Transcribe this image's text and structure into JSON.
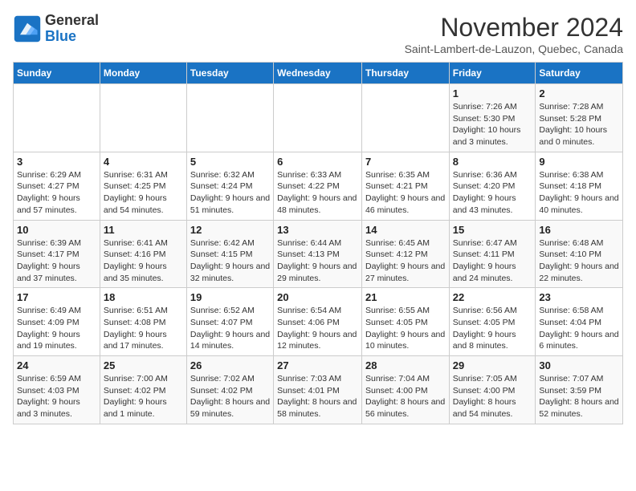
{
  "logo": {
    "text_general": "General",
    "text_blue": "Blue"
  },
  "header": {
    "month": "November 2024",
    "location": "Saint-Lambert-de-Lauzon, Quebec, Canada"
  },
  "days_of_week": [
    "Sunday",
    "Monday",
    "Tuesday",
    "Wednesday",
    "Thursday",
    "Friday",
    "Saturday"
  ],
  "weeks": [
    [
      {
        "day": "",
        "info": ""
      },
      {
        "day": "",
        "info": ""
      },
      {
        "day": "",
        "info": ""
      },
      {
        "day": "",
        "info": ""
      },
      {
        "day": "",
        "info": ""
      },
      {
        "day": "1",
        "info": "Sunrise: 7:26 AM\nSunset: 5:30 PM\nDaylight: 10 hours and 3 minutes."
      },
      {
        "day": "2",
        "info": "Sunrise: 7:28 AM\nSunset: 5:28 PM\nDaylight: 10 hours and 0 minutes."
      }
    ],
    [
      {
        "day": "3",
        "info": "Sunrise: 6:29 AM\nSunset: 4:27 PM\nDaylight: 9 hours and 57 minutes."
      },
      {
        "day": "4",
        "info": "Sunrise: 6:31 AM\nSunset: 4:25 PM\nDaylight: 9 hours and 54 minutes."
      },
      {
        "day": "5",
        "info": "Sunrise: 6:32 AM\nSunset: 4:24 PM\nDaylight: 9 hours and 51 minutes."
      },
      {
        "day": "6",
        "info": "Sunrise: 6:33 AM\nSunset: 4:22 PM\nDaylight: 9 hours and 48 minutes."
      },
      {
        "day": "7",
        "info": "Sunrise: 6:35 AM\nSunset: 4:21 PM\nDaylight: 9 hours and 46 minutes."
      },
      {
        "day": "8",
        "info": "Sunrise: 6:36 AM\nSunset: 4:20 PM\nDaylight: 9 hours and 43 minutes."
      },
      {
        "day": "9",
        "info": "Sunrise: 6:38 AM\nSunset: 4:18 PM\nDaylight: 9 hours and 40 minutes."
      }
    ],
    [
      {
        "day": "10",
        "info": "Sunrise: 6:39 AM\nSunset: 4:17 PM\nDaylight: 9 hours and 37 minutes."
      },
      {
        "day": "11",
        "info": "Sunrise: 6:41 AM\nSunset: 4:16 PM\nDaylight: 9 hours and 35 minutes."
      },
      {
        "day": "12",
        "info": "Sunrise: 6:42 AM\nSunset: 4:15 PM\nDaylight: 9 hours and 32 minutes."
      },
      {
        "day": "13",
        "info": "Sunrise: 6:44 AM\nSunset: 4:13 PM\nDaylight: 9 hours and 29 minutes."
      },
      {
        "day": "14",
        "info": "Sunrise: 6:45 AM\nSunset: 4:12 PM\nDaylight: 9 hours and 27 minutes."
      },
      {
        "day": "15",
        "info": "Sunrise: 6:47 AM\nSunset: 4:11 PM\nDaylight: 9 hours and 24 minutes."
      },
      {
        "day": "16",
        "info": "Sunrise: 6:48 AM\nSunset: 4:10 PM\nDaylight: 9 hours and 22 minutes."
      }
    ],
    [
      {
        "day": "17",
        "info": "Sunrise: 6:49 AM\nSunset: 4:09 PM\nDaylight: 9 hours and 19 minutes."
      },
      {
        "day": "18",
        "info": "Sunrise: 6:51 AM\nSunset: 4:08 PM\nDaylight: 9 hours and 17 minutes."
      },
      {
        "day": "19",
        "info": "Sunrise: 6:52 AM\nSunset: 4:07 PM\nDaylight: 9 hours and 14 minutes."
      },
      {
        "day": "20",
        "info": "Sunrise: 6:54 AM\nSunset: 4:06 PM\nDaylight: 9 hours and 12 minutes."
      },
      {
        "day": "21",
        "info": "Sunrise: 6:55 AM\nSunset: 4:05 PM\nDaylight: 9 hours and 10 minutes."
      },
      {
        "day": "22",
        "info": "Sunrise: 6:56 AM\nSunset: 4:05 PM\nDaylight: 9 hours and 8 minutes."
      },
      {
        "day": "23",
        "info": "Sunrise: 6:58 AM\nSunset: 4:04 PM\nDaylight: 9 hours and 6 minutes."
      }
    ],
    [
      {
        "day": "24",
        "info": "Sunrise: 6:59 AM\nSunset: 4:03 PM\nDaylight: 9 hours and 3 minutes."
      },
      {
        "day": "25",
        "info": "Sunrise: 7:00 AM\nSunset: 4:02 PM\nDaylight: 9 hours and 1 minute."
      },
      {
        "day": "26",
        "info": "Sunrise: 7:02 AM\nSunset: 4:02 PM\nDaylight: 8 hours and 59 minutes."
      },
      {
        "day": "27",
        "info": "Sunrise: 7:03 AM\nSunset: 4:01 PM\nDaylight: 8 hours and 58 minutes."
      },
      {
        "day": "28",
        "info": "Sunrise: 7:04 AM\nSunset: 4:00 PM\nDaylight: 8 hours and 56 minutes."
      },
      {
        "day": "29",
        "info": "Sunrise: 7:05 AM\nSunset: 4:00 PM\nDaylight: 8 hours and 54 minutes."
      },
      {
        "day": "30",
        "info": "Sunrise: 7:07 AM\nSunset: 3:59 PM\nDaylight: 8 hours and 52 minutes."
      }
    ]
  ]
}
